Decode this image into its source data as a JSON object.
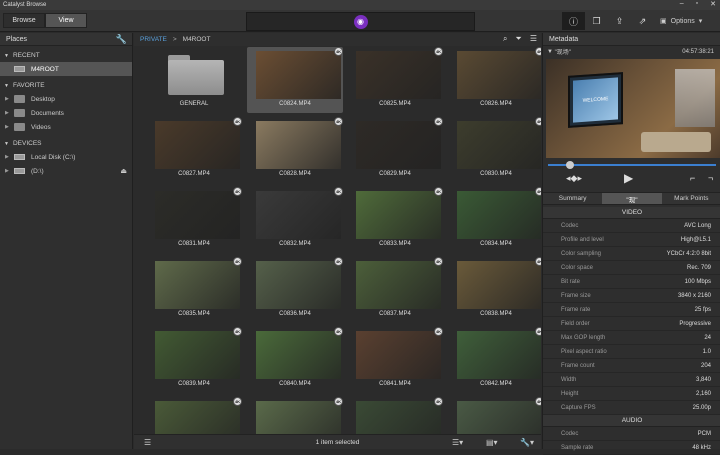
{
  "app": {
    "title": "Catalyst Browse"
  },
  "modes": [
    {
      "label": "Browse",
      "active": false
    },
    {
      "label": "View",
      "active": true
    }
  ],
  "toolbar": {
    "options_label": "Options",
    "info_icon": "info-icon",
    "logo_icon": "eye-icon"
  },
  "places": {
    "header": "Places",
    "recent_label": "RECENT",
    "recent_items": [
      {
        "label": "M4ROOT"
      }
    ],
    "favorite_label": "FAVORITE",
    "favorite_items": [
      {
        "label": "Desktop"
      },
      {
        "label": "Documents"
      },
      {
        "label": "Videos"
      }
    ],
    "devices_label": "DEVICES",
    "device_items": [
      {
        "label": "Local Disk (C:\\)"
      },
      {
        "label": "(D:\\)"
      }
    ]
  },
  "breadcrumb": {
    "root": "PRIVATE",
    "separator": ">",
    "current": "M4ROOT"
  },
  "clips": [
    {
      "label": "GENERAL"
    },
    {
      "label": "C0824.MP4"
    },
    {
      "label": "C0825.MP4"
    },
    {
      "label": "C0826.MP4"
    },
    {
      "label": "C0827.MP4"
    },
    {
      "label": "C0828.MP4"
    },
    {
      "label": "C0829.MP4"
    },
    {
      "label": "C0830.MP4"
    },
    {
      "label": "C0831.MP4"
    },
    {
      "label": "C0832.MP4"
    },
    {
      "label": "C0833.MP4"
    },
    {
      "label": "C0834.MP4"
    },
    {
      "label": "C0835.MP4"
    },
    {
      "label": "C0836.MP4"
    },
    {
      "label": "C0837.MP4"
    },
    {
      "label": "C0838.MP4"
    },
    {
      "label": "C0839.MP4"
    },
    {
      "label": "C0840.MP4"
    },
    {
      "label": "C0841.MP4"
    },
    {
      "label": "C0842.MP4"
    },
    {
      "label": ""
    },
    {
      "label": ""
    },
    {
      "label": ""
    },
    {
      "label": ""
    }
  ],
  "thumb_colors": [
    "#6b4e33",
    "#3a3128",
    "#5a4a33",
    "#4a3a2a",
    "#8a7a60",
    "#2e2a26",
    "#3d3d2d",
    "#2c2c28",
    "#3a3a3a",
    "#4f6b3a",
    "#3a5a35",
    "#5f6a4a",
    "#55604a",
    "#4c5f3a",
    "#6a5a3a",
    "#425a33",
    "#4a6a3a",
    "#5a4030",
    "#3f5f3a",
    "#4a5a38",
    "#5a6a4a",
    "#3a4a35",
    "#4a5a45"
  ],
  "status": {
    "text": "1 item selected"
  },
  "metadata": {
    "header": "Metadata",
    "clip_name": "\"现场\"",
    "timecode": "04:57:38:21",
    "tv_text": "WELCOME",
    "tabs": [
      {
        "label": "Summary",
        "active": false
      },
      {
        "label": "\"现\"",
        "active": true
      },
      {
        "label": "Mark Points",
        "active": false
      }
    ],
    "video_section": "VIDEO",
    "video_rows": [
      {
        "k": "Codec",
        "v": "AVC Long"
      },
      {
        "k": "Profile and level",
        "v": "High@L5.1"
      },
      {
        "k": "Color sampling",
        "v": "YCbCr 4:2:0 8bit"
      },
      {
        "k": "Color space",
        "v": "Rec. 709"
      },
      {
        "k": "Bit rate",
        "v": "100 Mbps"
      },
      {
        "k": "Frame size",
        "v": "3840 x 2160"
      },
      {
        "k": "Frame rate",
        "v": "25 fps"
      },
      {
        "k": "Field order",
        "v": "Progressive"
      },
      {
        "k": "Max GOP length",
        "v": "24"
      },
      {
        "k": "Pixel aspect ratio",
        "v": "1.0"
      },
      {
        "k": "Frame count",
        "v": "204"
      },
      {
        "k": "Width",
        "v": "3,840"
      },
      {
        "k": "Height",
        "v": "2,160"
      },
      {
        "k": "Capture FPS",
        "v": "25.00p"
      }
    ],
    "audio_section": "AUDIO",
    "audio_rows": [
      {
        "k": "Codec",
        "v": "PCM"
      },
      {
        "k": "Sample rate",
        "v": "48 kHz"
      }
    ]
  }
}
